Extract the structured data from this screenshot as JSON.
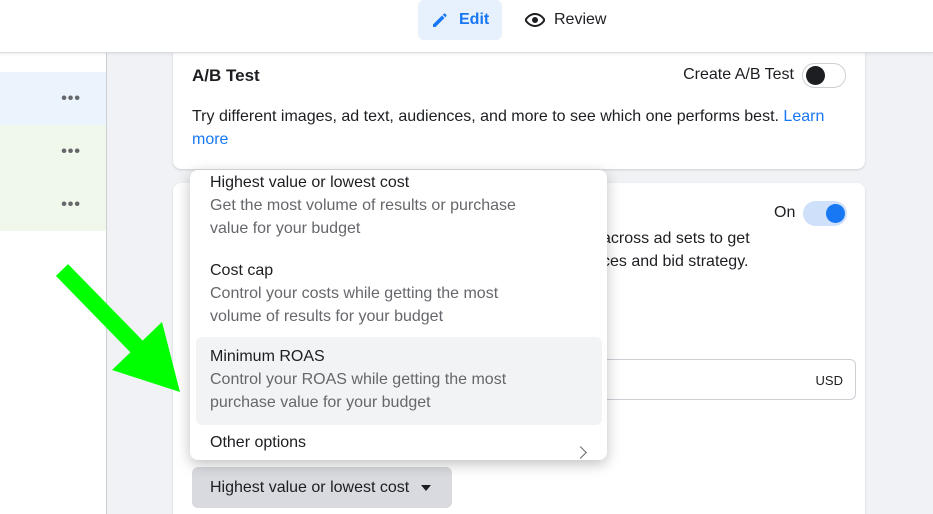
{
  "header": {
    "tabs": [
      {
        "label": "Edit",
        "icon": "pencil-icon",
        "active": true
      },
      {
        "label": "Review",
        "icon": "eye-icon",
        "active": false
      }
    ]
  },
  "left_panel": {
    "items": [
      {
        "menu": "•••",
        "bg": "#ebf3fd"
      },
      {
        "menu": "•••",
        "bg": "#eff8ea"
      },
      {
        "menu": "•••",
        "bg": "#eff8ea"
      }
    ]
  },
  "ab_test": {
    "title": "A/B Test",
    "toggle_label": "Create A/B Test",
    "toggle_on": false,
    "description": "Try different images, ad text, audiences, and more to see which one performs best.",
    "link_text": "Learn more"
  },
  "budget": {
    "cbo_label": "On",
    "cbo_toggle_on": true,
    "partial_line_1": "across ad sets to get",
    "partial_line_2": "ces and bid strategy.",
    "currency": "USD",
    "selected_strategy": "Highest value or lowest cost"
  },
  "dropdown": {
    "options": [
      {
        "title": "Highest value or lowest cost",
        "description": "Get the most volume of results or purchase value for your budget"
      },
      {
        "title": "Cost cap",
        "description": "Control your costs while getting the most volume of results for your budget"
      },
      {
        "title": "Minimum ROAS",
        "description": "Control your ROAS while getting the most purchase value for your budget",
        "highlighted": true
      },
      {
        "title": "Other options",
        "description": "",
        "has_submenu": true
      }
    ]
  },
  "colors": {
    "accent": "#1877f2",
    "arrow": "#00ff00"
  }
}
